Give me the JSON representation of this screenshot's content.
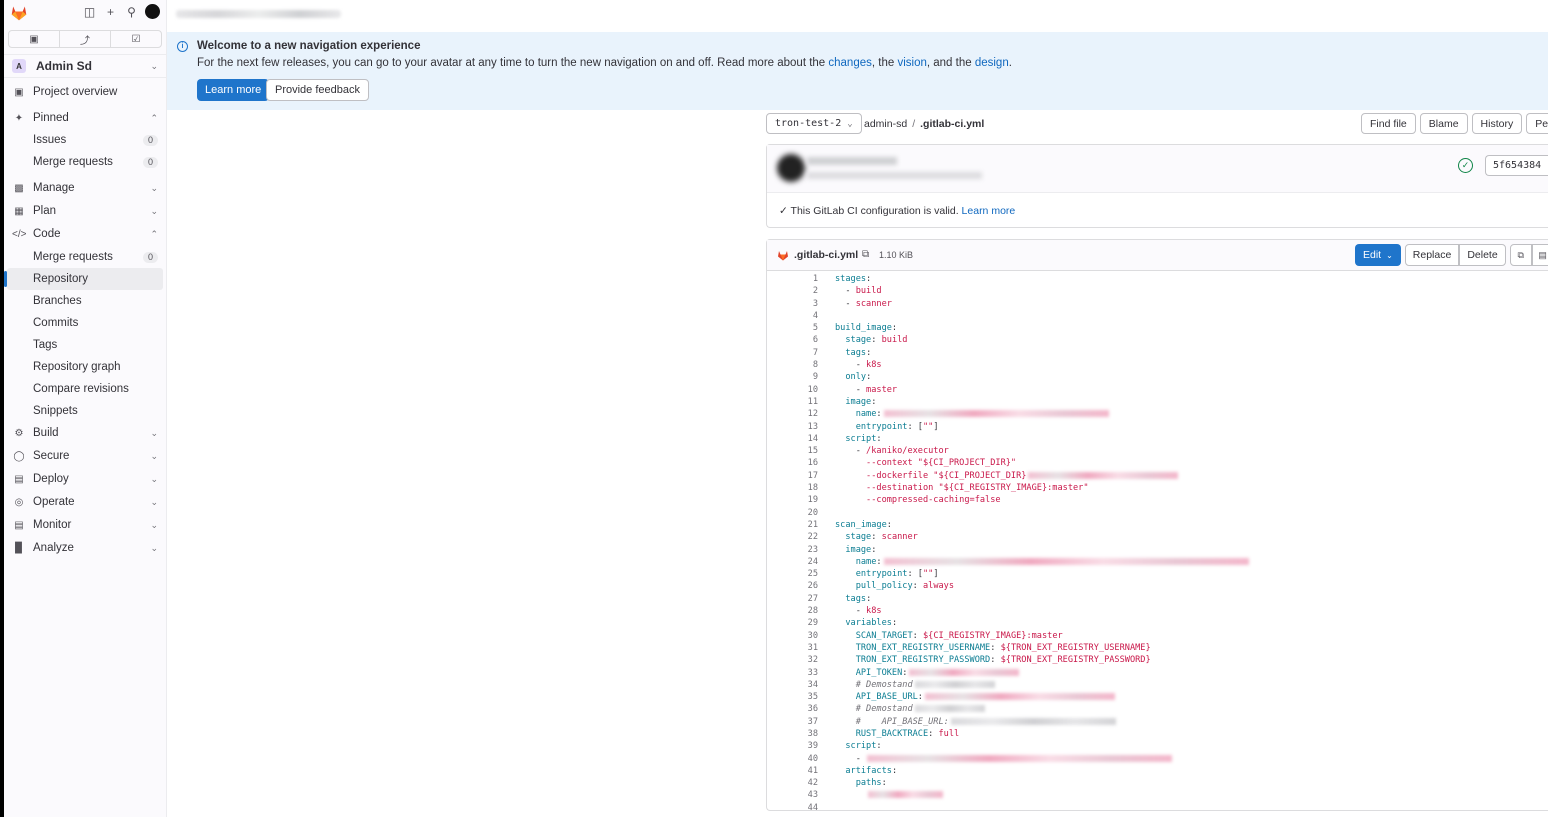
{
  "sidebar": {
    "context_letter": "A",
    "context_name": "Admin Sd",
    "items": [
      {
        "icon": "project-icon",
        "label": "Project overview"
      },
      {
        "icon": "pin-icon",
        "label": "Pinned"
      },
      {
        "label": "Issues",
        "badge": "0"
      },
      {
        "label": "Merge requests",
        "badge": "0"
      },
      {
        "icon": "manage-icon",
        "label": "Manage"
      },
      {
        "icon": "plan-icon",
        "label": "Plan"
      },
      {
        "icon": "code-icon",
        "label": "Code"
      },
      {
        "label": "Merge requests",
        "badge": "0"
      },
      {
        "label": "Repository"
      },
      {
        "label": "Branches"
      },
      {
        "label": "Commits"
      },
      {
        "label": "Tags"
      },
      {
        "label": "Repository graph"
      },
      {
        "label": "Compare revisions"
      },
      {
        "label": "Snippets"
      },
      {
        "icon": "build-icon",
        "label": "Build"
      },
      {
        "icon": "secure-icon",
        "label": "Secure"
      },
      {
        "icon": "deploy-icon",
        "label": "Deploy"
      },
      {
        "icon": "operate-icon",
        "label": "Operate"
      },
      {
        "icon": "monitor-icon",
        "label": "Monitor"
      },
      {
        "icon": "analyze-icon",
        "label": "Analyze"
      }
    ]
  },
  "banner": {
    "title": "Welcome to a new navigation experience",
    "text_before": "For the next few releases, you can go to your avatar at any time to turn the new navigation on and off. Read more about the ",
    "link_changes": "changes",
    "text_mid1": ", the ",
    "link_vision": "vision",
    "text_mid2": ", and the ",
    "link_design": "design",
    "text_end": ".",
    "learn_more": "Learn more",
    "feedback": "Provide feedback"
  },
  "file_header": {
    "branch": "tron-test-2",
    "crumb_root": "admin-sd",
    "crumb_sep": "/",
    "crumb_file": ".gitlab-ci.yml",
    "buttons": [
      "Find file",
      "Blame",
      "History",
      "Perma"
    ]
  },
  "commit": {
    "sha": "5f654384",
    "ci_valid_text": "This GitLab CI configuration is valid.",
    "ci_learn_more": "Learn more"
  },
  "file": {
    "name": ".gitlab-ci.yml",
    "size": "1.10 KiB",
    "edit": "Edit",
    "replace": "Replace",
    "delete": "Delete"
  },
  "colors": {
    "accent": "#1f75cb",
    "banner_bg": "#e9f3fc",
    "success": "#108548"
  }
}
